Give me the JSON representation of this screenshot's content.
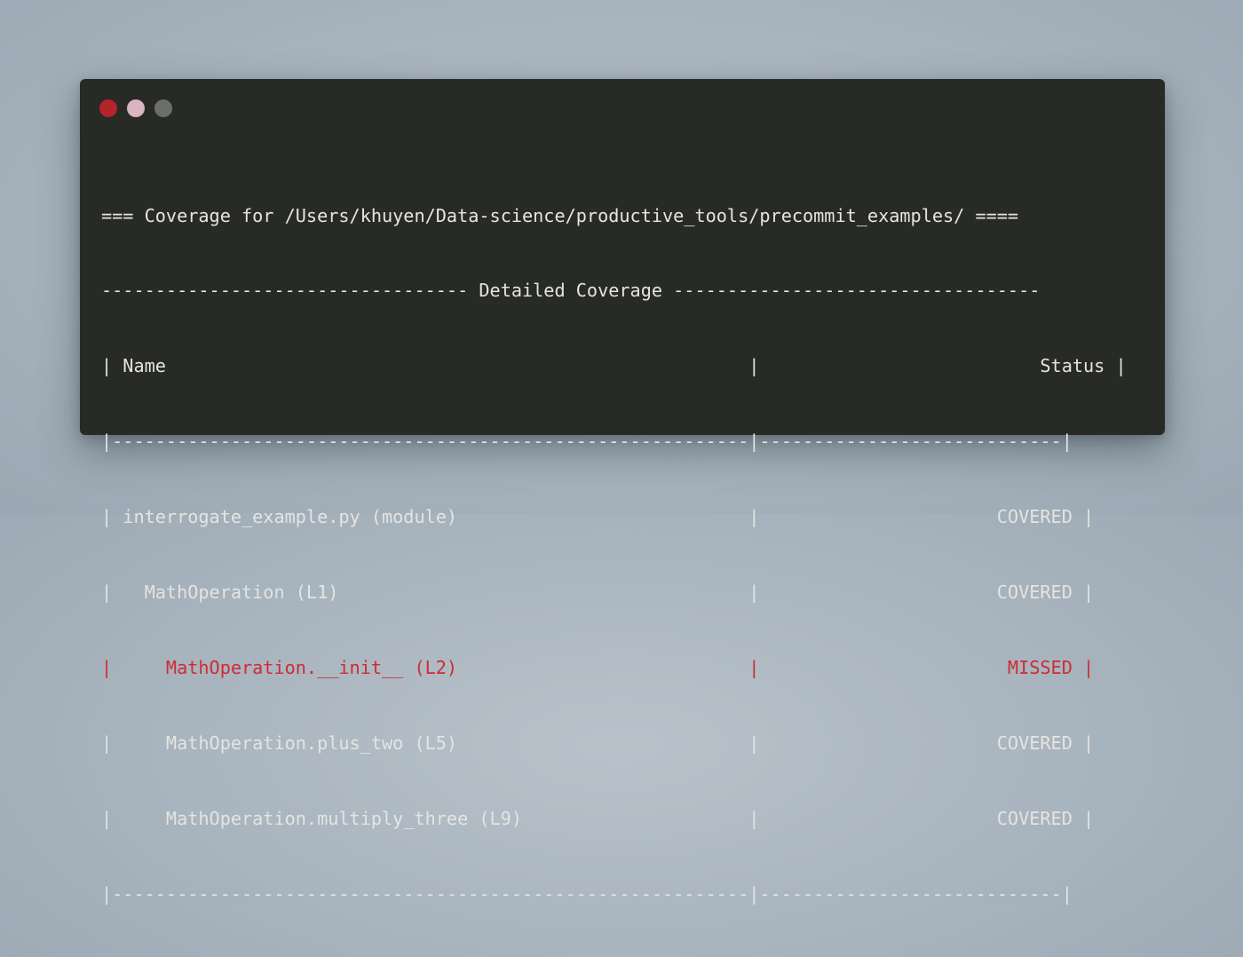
{
  "window": {
    "buttons": [
      {
        "name": "close",
        "color": "#b5232b"
      },
      {
        "name": "minimize",
        "color": "#d9b4c1"
      },
      {
        "name": "maximize",
        "color": "#6b6e6b"
      }
    ]
  },
  "colors": {
    "background": "#a7b3bd",
    "terminal_bg": "#282a26",
    "text": "#e4e4e2",
    "missed": "#cf2b33"
  },
  "terminal": {
    "title_line": "=== Coverage for /Users/khuyen/Data-science/productive_tools/precommit_examples/ ====",
    "detail_header_line": "---------------------------------- Detailed Coverage ----------------------------------",
    "table_header_line": "| Name                                                      |                          Status |",
    "separator_top": "|-----------------------------------------------------------|----------------------------|",
    "rows": [
      {
        "line": "| interrogate_example.py (module)                           |                      COVERED |",
        "status": "COVERED"
      },
      {
        "line": "|   MathOperation (L1)                                      |                      COVERED |",
        "status": "COVERED"
      },
      {
        "line": "|     MathOperation.__init__ (L2)                           |                       MISSED |",
        "status": "MISSED"
      },
      {
        "line": "|     MathOperation.plus_two (L5)                           |                      COVERED |",
        "status": "COVERED"
      },
      {
        "line": "|     MathOperation.multiply_three (L9)                     |                      COVERED |",
        "status": "COVERED"
      }
    ],
    "separator_bottom": "|-----------------------------------------------------------|----------------------------|"
  }
}
